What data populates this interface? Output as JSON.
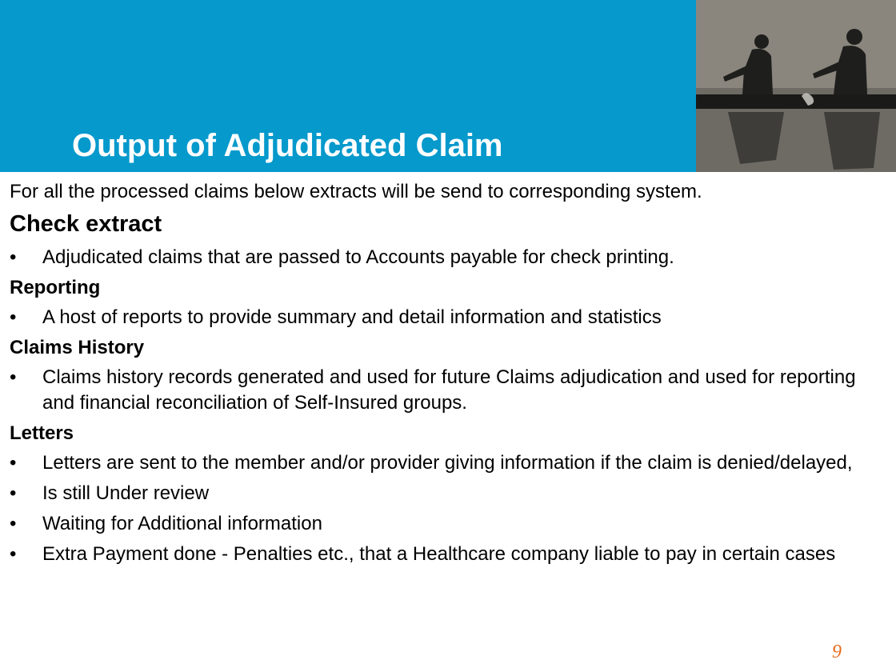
{
  "title": "Output of Adjudicated Claim",
  "intro": "For all the processed claims below extracts will be send to corresponding system.",
  "sections": [
    {
      "heading": "Check extract",
      "bullets": [
        "Adjudicated claims that are passed to Accounts payable for check printing."
      ]
    },
    {
      "heading": "Reporting",
      "bullets": [
        "A host of reports to provide summary and detail information and statistics"
      ]
    },
    {
      "heading": "Claims History",
      "bullets": [
        "Claims history records generated and used for future Claims adjudication and used for reporting and financial reconciliation of Self-Insured groups."
      ]
    },
    {
      "heading": "Letters",
      "bullets": [
        "Letters are sent to the member and/or provider giving information if the claim is denied/delayed,",
        "Is still Under review",
        "Waiting for Additional information",
        "Extra Payment done - Penalties etc., that a Healthcare company liable to pay in certain cases"
      ]
    }
  ],
  "bullet_symbol": "•",
  "page_number": "9",
  "colors": {
    "header": "#0599cc",
    "page_number": "#e96a1c"
  },
  "image": "rowers-silhouette-photo"
}
